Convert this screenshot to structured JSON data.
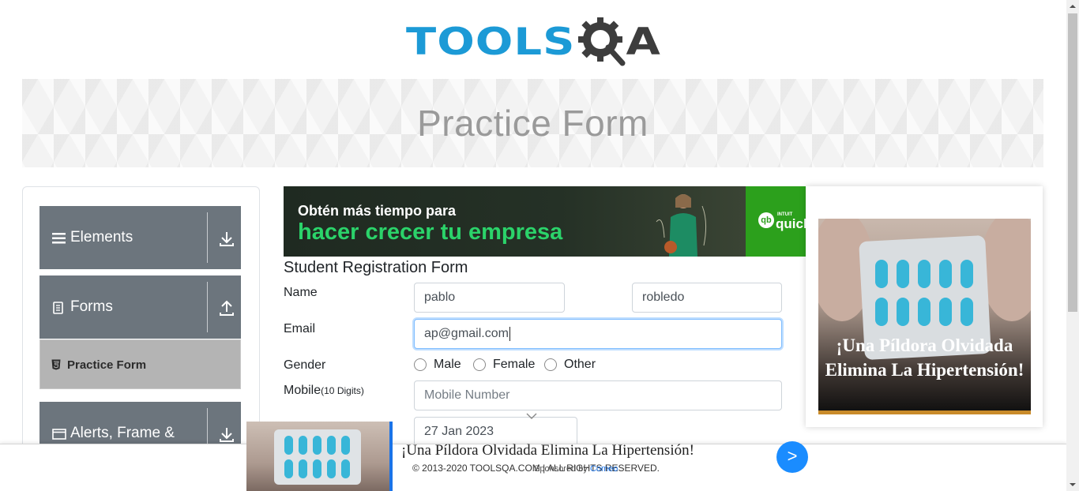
{
  "header": {
    "logo_text_primary": "TOOLS",
    "logo_text_secondary": "A",
    "logo_icon": "gear-magnifier-icon",
    "brand_colors": {
      "blue": "#1c9ad6",
      "dark": "#3d3d3d"
    }
  },
  "banner": {
    "title": "Practice Form"
  },
  "sidebar": {
    "groups": [
      {
        "label": "Elements",
        "icon": "menu-icon",
        "toggle_icon": "download-arrow-icon"
      },
      {
        "label": "Forms",
        "icon": "document-icon",
        "toggle_icon": "upload-arrow-icon"
      },
      {
        "label": "Alerts, Frame &",
        "icon": "window-icon",
        "toggle_icon": "download-arrow-icon"
      }
    ],
    "active_item": {
      "label": "Practice Form",
      "icon": "html5-icon"
    }
  },
  "ad_top": {
    "line1": "Obtén más tiempo para",
    "line2": "hacer crecer tu empresa",
    "brand_small": "INTUIT",
    "brand": "quick"
  },
  "form": {
    "title": "Student Registration Form",
    "name_label": "Name",
    "first_name_value": "pablo",
    "last_name_value": "robledo",
    "email_label": "Email",
    "email_value": "ap@gmail.com",
    "gender_label": "Gender",
    "gender_options": [
      "Male",
      "Female",
      "Other"
    ],
    "mobile_label": "Mobile",
    "mobile_hint": "(10 Digits)",
    "mobile_placeholder": "Mobile Number",
    "date_value": "27 Jan 2023"
  },
  "ad_right": {
    "headline": "¡Una Píldora Olvidada Elimina La Hipertensión!"
  },
  "bottom_ad": {
    "headline": "¡Una Píldora Olvidada Elimina La Hipertensión!",
    "footer": "© 2013-2020 TOOLSQA.COM | ALL RIGHTS RESERVED.",
    "sponsor_prefix": "Sponsored by",
    "sponsor_brand": "Comeo",
    "next_label": ">"
  }
}
